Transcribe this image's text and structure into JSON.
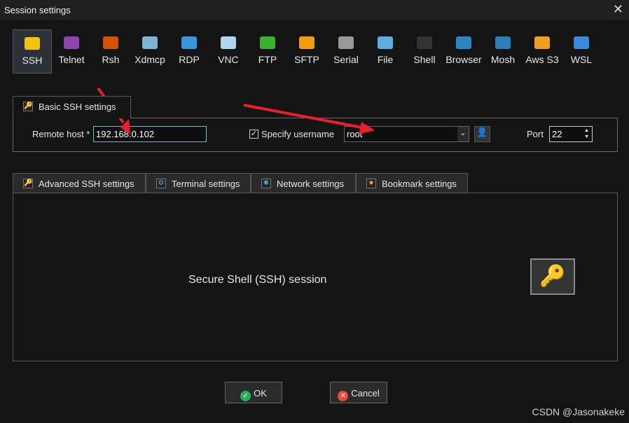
{
  "window": {
    "title": "Session settings",
    "close": "✕"
  },
  "protocols": [
    {
      "label": "SSH",
      "color": "#f1c40f",
      "selected": true
    },
    {
      "label": "Telnet",
      "color": "#8e44ad"
    },
    {
      "label": "Rsh",
      "color": "#d35400"
    },
    {
      "label": "Xdmcp",
      "color": "#7fb3d5"
    },
    {
      "label": "RDP",
      "color": "#3498db"
    },
    {
      "label": "VNC",
      "color": "#aed6f1"
    },
    {
      "label": "FTP",
      "color": "#3cb02e"
    },
    {
      "label": "SFTP",
      "color": "#f39c12"
    },
    {
      "label": "Serial",
      "color": "#999999"
    },
    {
      "label": "File",
      "color": "#5dade2"
    },
    {
      "label": "Shell",
      "color": "#333333"
    },
    {
      "label": "Browser",
      "color": "#2e86c1"
    },
    {
      "label": "Mosh",
      "color": "#2980b9"
    },
    {
      "label": "Aws S3",
      "color": "#f0a020"
    },
    {
      "label": "WSL",
      "color": "#3b8ad9"
    }
  ],
  "basic": {
    "tab": "Basic SSH settings",
    "remote_host_label": "Remote host *",
    "remote_host": "192.168.0.102",
    "specify_username_label": "Specify username",
    "specify_username_checked": true,
    "username": "root",
    "port_label": "Port",
    "port": "22"
  },
  "tabs": [
    "Advanced SSH settings",
    "Terminal settings",
    "Network settings",
    "Bookmark settings"
  ],
  "panel": {
    "description": "Secure Shell (SSH) session"
  },
  "buttons": {
    "ok": "OK",
    "cancel": "Cancel"
  },
  "watermark": "CSDN @Jasonakeke"
}
